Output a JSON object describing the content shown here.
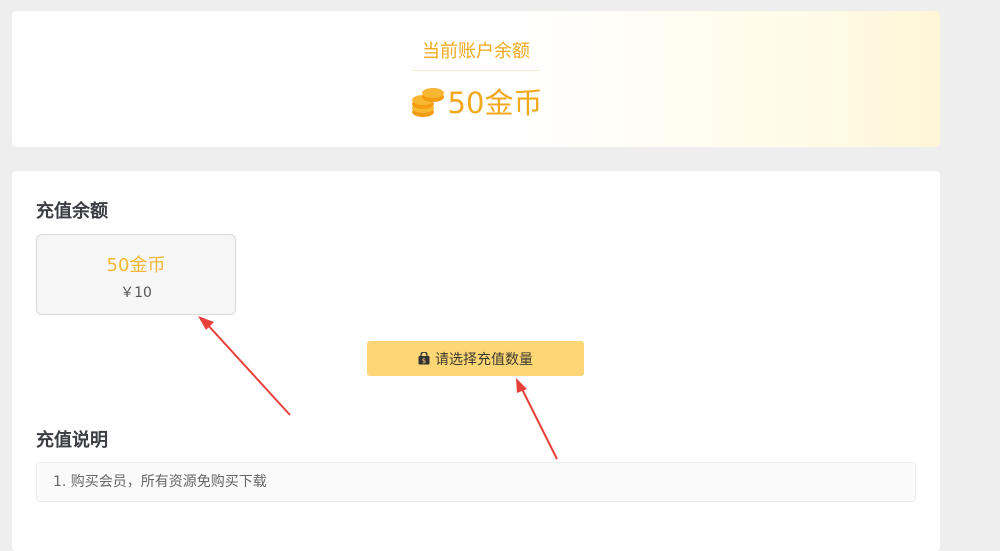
{
  "balance": {
    "title": "当前账户余额",
    "amount": "50金币",
    "icon": "coins-stack-icon"
  },
  "recharge": {
    "section_title": "充值余额",
    "options": [
      {
        "coins": "50金币",
        "price": "￥10"
      }
    ],
    "button_label": "请选择充值数量",
    "button_icon": "shopping-bag-icon"
  },
  "description": {
    "section_title": "充值说明",
    "items": [
      "1. 购买会员，所有资源免购买下载"
    ]
  },
  "colors": {
    "accent": "#f0a81c",
    "button_bg": "#fdd675",
    "annotation_arrow": "#e8413c"
  }
}
